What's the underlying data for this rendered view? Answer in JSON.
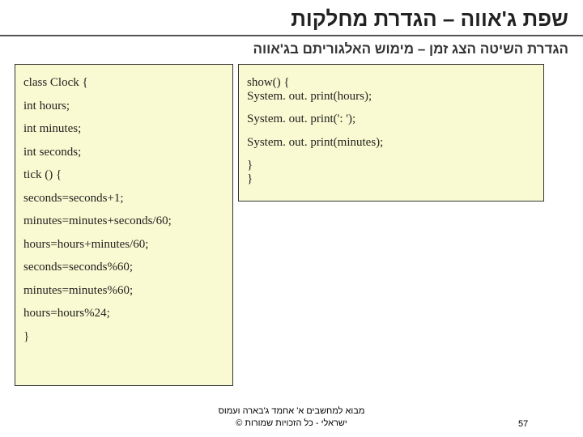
{
  "title": "שפת ג'אווה – הגדרת מחלקות",
  "subtitle": "הגדרת השיטה הצג זמן – מימוש האלגוריתם בג'אווה",
  "code_left": [
    "class  Clock {",
    "int hours;",
    "int minutes;",
    "int seconds;",
    "tick () {",
    " seconds=seconds+1;",
    " minutes=minutes+seconds/60;",
    " hours=hours+minutes/60;",
    " seconds=seconds%60;",
    " minutes=minutes%60;",
    " hours=hours%24;",
    " }"
  ],
  "code_right": [
    "show() {",
    "System. out. print(hours);",
    "System. out. print(': ');",
    "System. out. print(minutes);",
    "  }",
    " }"
  ],
  "footer": {
    "credit_line1": "מבוא למחשבים א' אחמד ג'בארה ועמוס",
    "credit_line2": "ישראלי - כל הזכויות שמורות ©",
    "page": "57"
  }
}
